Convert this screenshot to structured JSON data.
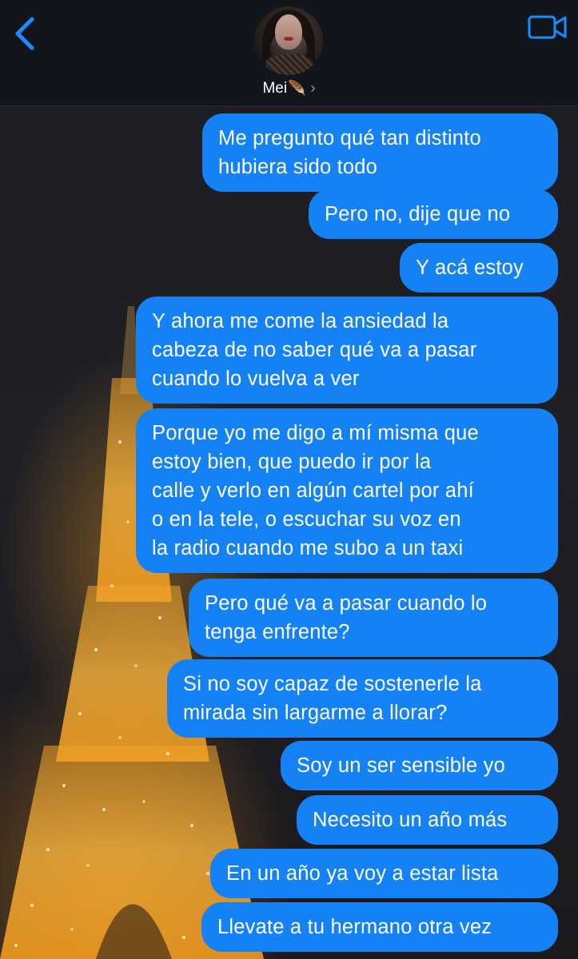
{
  "header": {
    "contact_name": "Mei",
    "name_emoji": "🪶",
    "chevron": "›",
    "back_icon": "chevron-left-icon",
    "video_icon": "video-camera-icon",
    "accent_color": "#1482f5"
  },
  "messages": [
    {
      "sender": "me",
      "text": "Me pregunto qué tan distinto\nhubiera sido todo"
    },
    {
      "sender": "me",
      "text": "Pero no, dije que no"
    },
    {
      "sender": "me",
      "text": "Y acá estoy"
    },
    {
      "sender": "me",
      "text": "Y ahora me come la ansiedad la\ncabeza de no saber qué va a pasar\ncuando lo vuelva a ver"
    },
    {
      "sender": "me",
      "text": "Porque yo me digo a mí misma que\nestoy bien, que puedo ir por la\ncalle y verlo en algún cartel por ahí\no en la tele, o escuchar su voz en\nla radio cuando me subo a un taxi"
    },
    {
      "sender": "me",
      "text": "Pero qué va a pasar cuando lo\ntenga enfrente?"
    },
    {
      "sender": "me",
      "text": "Si no soy capaz de sostenerle la\nmirada sin largarme a llorar?"
    },
    {
      "sender": "me",
      "text": "Soy un ser sensible yo"
    },
    {
      "sender": "me",
      "text": "Necesito un año más"
    },
    {
      "sender": "me",
      "text": "En un año ya voy a estar lista"
    },
    {
      "sender": "me",
      "text": "Llevate a tu hermano otra vez"
    }
  ]
}
